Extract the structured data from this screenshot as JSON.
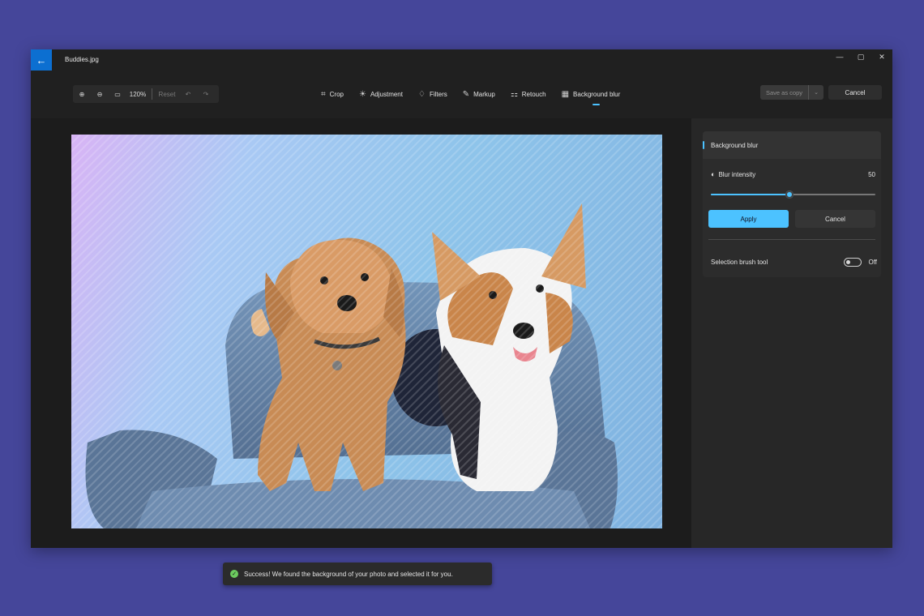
{
  "window": {
    "file_title": "Buddies.jpg",
    "back_icon": "←",
    "minimize": "—",
    "maximize": "▢",
    "close": "✕"
  },
  "zoom": {
    "zoom_in_icon": "⊕",
    "zoom_out_icon": "⊖",
    "fit_icon": "▭",
    "level": "120%",
    "reset_label": "Reset",
    "undo_icon": "↶",
    "redo_icon": "↷"
  },
  "tools": [
    {
      "label": "Crop",
      "icon": "⌗"
    },
    {
      "label": "Adjustment",
      "icon": "☀"
    },
    {
      "label": "Filters",
      "icon": "♢"
    },
    {
      "label": "Markup",
      "icon": "✎"
    },
    {
      "label": "Retouch",
      "icon": "⚏"
    },
    {
      "label": "Background blur",
      "icon": "▦"
    }
  ],
  "actions": {
    "save_as_copy": "Save as copy",
    "save_dropdown_icon": "⌄",
    "cancel": "Cancel"
  },
  "toast": {
    "icon": "✓",
    "message": "Success! We found the background of your photo and selected it for you."
  },
  "panel": {
    "header": "Background blur",
    "blur_icon": "◐",
    "blur_label": "Blur intensity",
    "blur_value": "50",
    "blur_fraction": 0.48,
    "apply": "Apply",
    "cancel": "Cancel",
    "brush_label": "Selection brush tool",
    "brush_state": "Off"
  },
  "colors": {
    "accent": "#4cc2ff",
    "title_back": "#0c6fd1",
    "success": "#6ccb5f",
    "backdrop": "#45469a"
  }
}
